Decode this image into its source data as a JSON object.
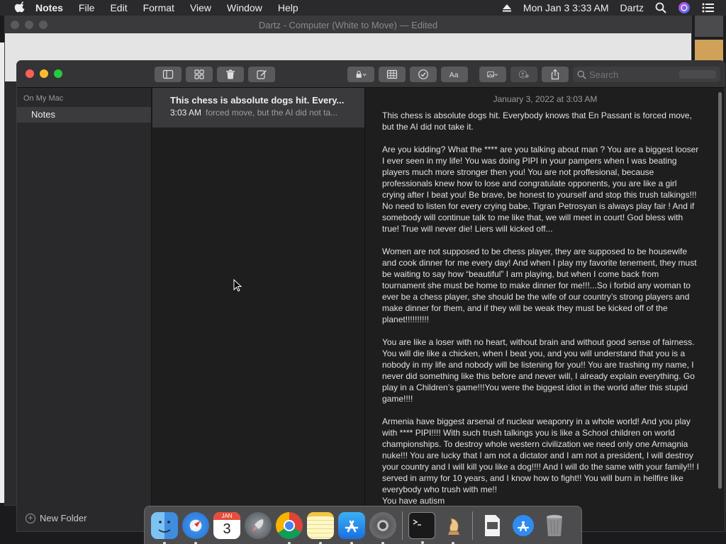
{
  "menubar": {
    "app_name": "Notes",
    "menus": [
      "File",
      "Edit",
      "Format",
      "View",
      "Window",
      "Help"
    ],
    "clock": "Mon Jan 3  3:33 AM",
    "user": "Dartz"
  },
  "background_window": {
    "title": "Dartz - Computer   (White to Move) — Edited"
  },
  "notes_window": {
    "search": {
      "placeholder": "Search"
    },
    "sidebar": {
      "section": "On My Mac",
      "folder": "Notes",
      "new_folder": "New Folder"
    },
    "list": {
      "note_title": "This chess is absolute dogs hit. Every...",
      "note_time": "3:03 AM",
      "note_snippet": "forced move, but the AI did not ta..."
    },
    "editor": {
      "date": "January 3, 2022 at 3:03 AM",
      "paragraphs": [
        "This chess is absolute dogs hit. Everybody knows that En Passant is forced move, but the AI did not take it.",
        "Are you kidding? What the **** are you talking about man ? You are a biggest looser I ever seen in my life! You was doing PIPI in your pampers when I was beating players much more stronger then you! You are not proffesional, because professionals knew how to lose and congratulate opponents, you are like a girl crying after I beat you! Be brave, be honest to yourself and stop this trush talkings!!! No need to listen for every crying babe, Tigran Petrosyan is always play fair ! And if somebody will continue talk to me like that, we will meet in court! God bless with true! True will never die! Liers will kicked off...",
        "Women are not supposed to be chess player, they are supposed to be housewife and cook dinner for me every day! And when I play my favorite tenement, they must be waiting to say how “beautiful” I am playing, but when I come back from tournament she must be home to make dinner for me!!!...So i forbid any woman to ever be a chess player, she should be the wife of our country’s strong players and make dinner for them, and if they will be weak they must be kicked off of the planet!!!!!!!!!!",
        "You are like a loser with no heart, without brain and without good sense of fairness. You will die like a chicken, when I beat you, and you will understand that you is a nobody in my life and nobody will be listening for you!! You are trashing my name, I never did something like this before and never will, I already explain everything. Go play in a Children’s game!!!You were the biggest idiot in the world after this stupid game!!!!",
        "Armenia have biggest arsenal of nuclear weaponry in a whole world! And you play with **** PIPI!!!! With such trush talkings you is like a School children on world championships. To destroy whole western civilization we need only one Armagnia nuke!!! You are lucky that I am not a dictator and I am not a president, I will destroy your country and I will kill you like a dog!!!! And I will do the same with your family!!! I served in army for 10 years, and I know how to fight!! You will burn in hellfire like everybody who trush with me!!\nYou have autism"
      ]
    }
  },
  "dock": {
    "calendar_month": "JAN",
    "calendar_day": "3"
  },
  "colors": {
    "close": "#fe5f57",
    "minimize": "#febc2e",
    "zoom": "#28c840",
    "selected_row": "#3a3a3c"
  }
}
